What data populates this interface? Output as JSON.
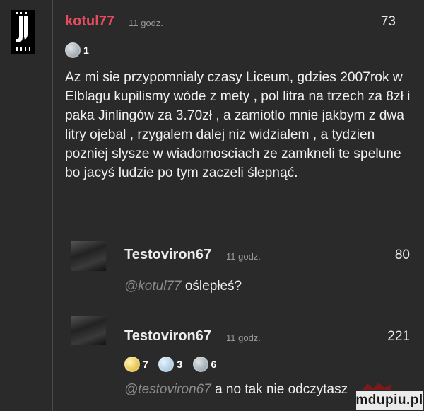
{
  "comments": [
    {
      "username": "kotul77",
      "time": "11 godz.",
      "score": "73",
      "badges": [
        {
          "icon": "medal-badge-icon",
          "count": "1"
        }
      ],
      "text": "Az mi sie przypomnialy czasy Liceum, gdzies 2007rok w Elblagu kupilismy wóde z mety , pol litra na trzech za 8zł i paka Jinlingów za 3.70zł , a zamiotlo mnie jakbym z dwa litry ojebal , rzygalem dalej niz widzialem , a tydzien pozniej slysze w wiadomosciach ze zamkneli te spelune bo jacyś ludzie po tym zaczeli ślepnąć.",
      "avatar": "juventus-logo"
    },
    {
      "username": "Testoviron67",
      "time": "11 godz.",
      "score": "80",
      "mention": "@kotul77",
      "text": "oślepłeś?",
      "avatar": "user-avatar"
    },
    {
      "username": "Testoviron67",
      "time": "11 godz.",
      "score": "221",
      "badges": [
        {
          "icon": "gold-award-icon",
          "count": "7"
        },
        {
          "icon": "silver-award-icon",
          "count": "3"
        },
        {
          "icon": "medal-award-icon",
          "count": "6"
        }
      ],
      "mention": "@testoviron67",
      "text": "a no tak nie odczytasz",
      "avatar": "user-avatar"
    }
  ],
  "watermark": "mdupiu.pl",
  "colors": {
    "username_accent": "#e74c5e",
    "username_default": "#ececec",
    "background": "#2a2a2a",
    "muted": "#9a9a9a"
  }
}
